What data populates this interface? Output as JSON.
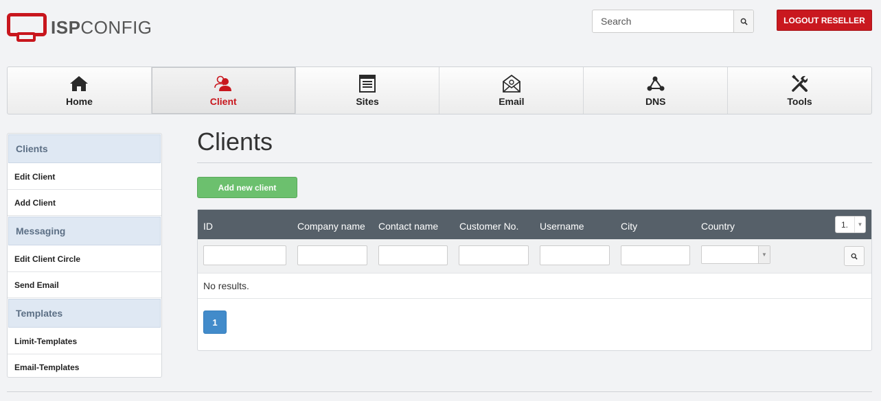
{
  "brand": {
    "logo_bold": "ISP",
    "logo_light": "CONFIG"
  },
  "header": {
    "search_placeholder": "Search",
    "logout_label": "LOGOUT RESELLER"
  },
  "nav": [
    {
      "label": "Home",
      "icon": "home-icon"
    },
    {
      "label": "Client",
      "icon": "users-icon",
      "active": true
    },
    {
      "label": "Sites",
      "icon": "sites-icon"
    },
    {
      "label": "Email",
      "icon": "email-icon"
    },
    {
      "label": "DNS",
      "icon": "dns-icon"
    },
    {
      "label": "Tools",
      "icon": "tools-icon"
    }
  ],
  "sidebar": {
    "sections": [
      {
        "title": "Clients",
        "items": [
          "Edit Client",
          "Add Client"
        ]
      },
      {
        "title": "Messaging",
        "items": [
          "Edit Client Circle",
          "Send Email"
        ]
      },
      {
        "title": "Templates",
        "items": [
          "Limit-Templates",
          "Email-Templates"
        ]
      }
    ]
  },
  "main": {
    "title": "Clients",
    "add_button": "Add new client",
    "table": {
      "columns": [
        "ID",
        "Company name",
        "Contact name",
        "Customer No.",
        "Username",
        "City",
        "Country"
      ],
      "page_size": "1.",
      "empty_text": "No results.",
      "current_page": "1"
    }
  },
  "colors": {
    "brand_red": "#c8161d",
    "table_header": "#566069",
    "add_green": "#6cc06e",
    "pager_blue": "#428bca"
  }
}
